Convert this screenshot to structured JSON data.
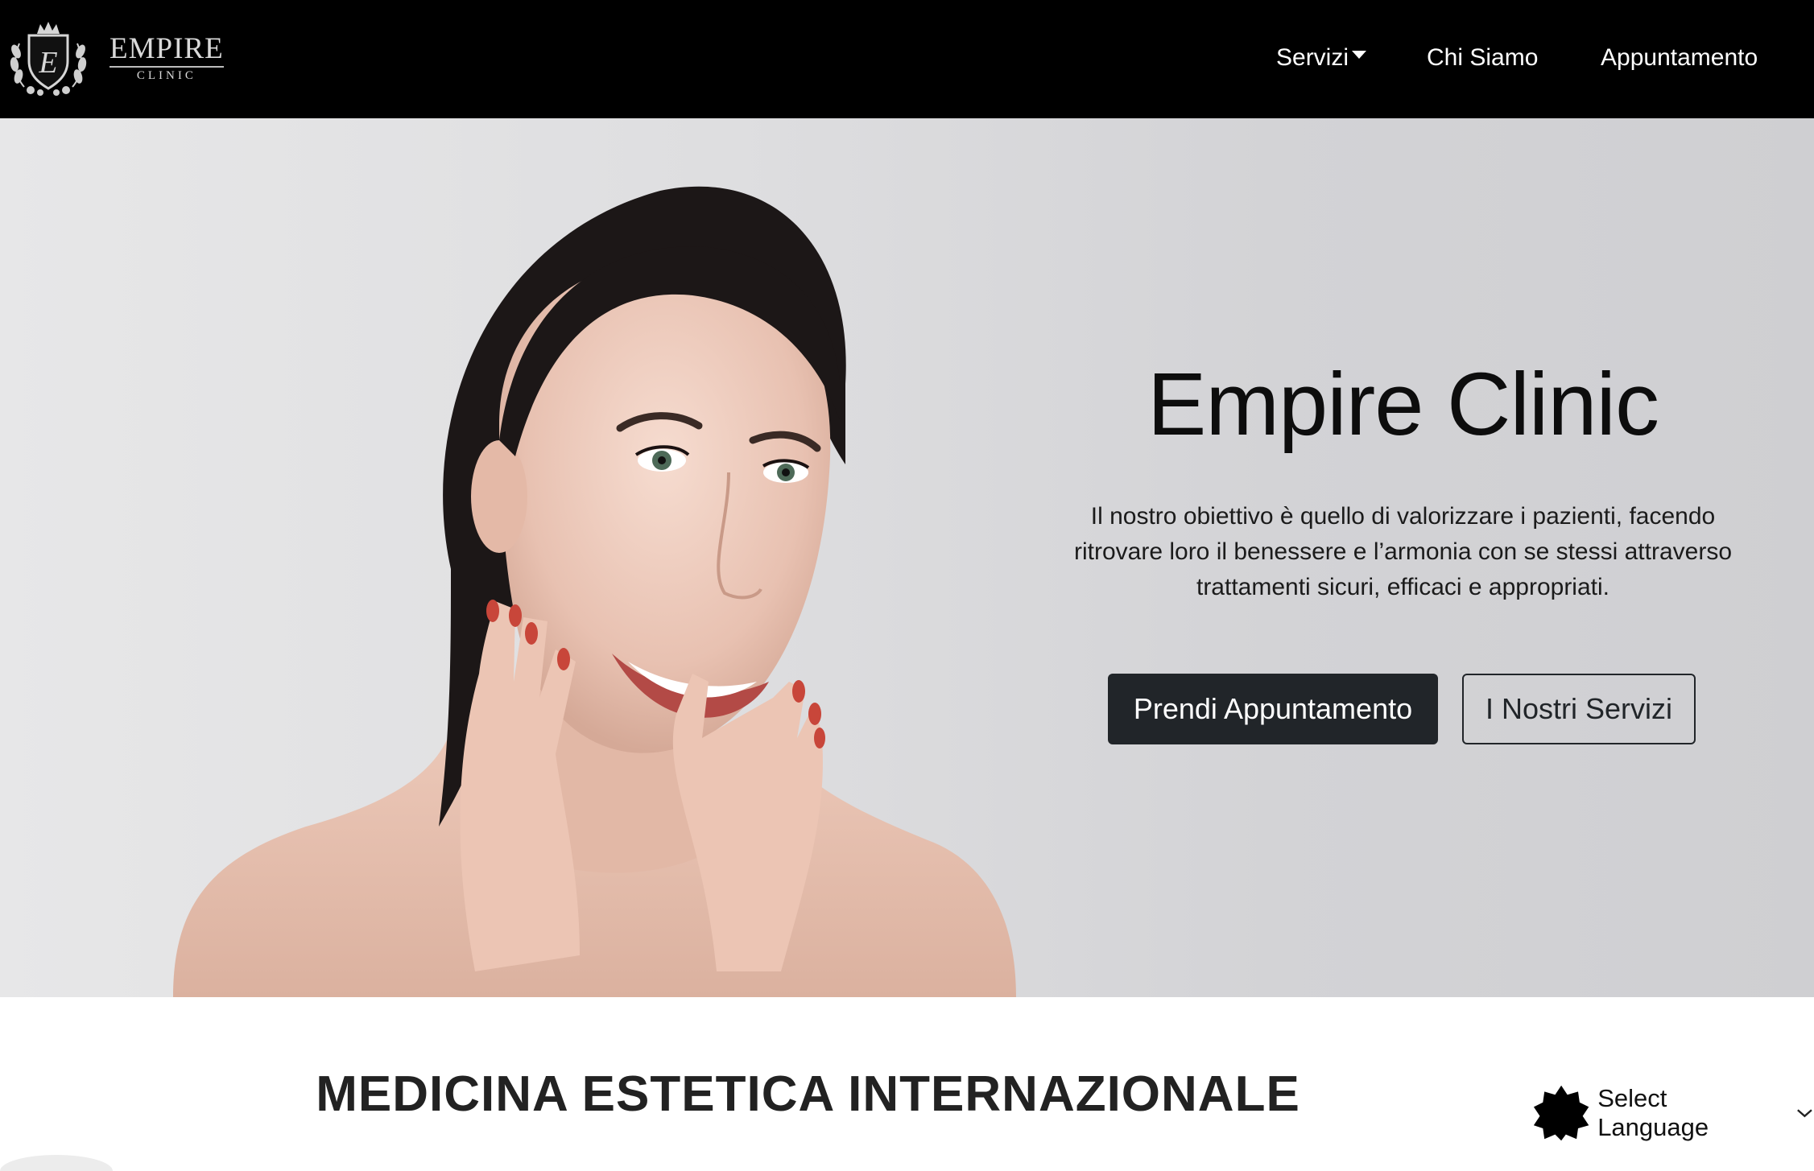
{
  "brand": {
    "name": "EMPIRE",
    "sub": "CLINIC",
    "monogram": "E",
    "crest_icon": "crest-logo-icon"
  },
  "nav": {
    "items": [
      {
        "label": "Servizi",
        "has_dropdown": true,
        "icon": "caret-down-icon"
      },
      {
        "label": "Chi Siamo"
      },
      {
        "label": "Appuntamento"
      }
    ]
  },
  "hero": {
    "title": "Empire Clinic",
    "text": "Il nostro obiettivo è quello di valorizzare i pazienti, facendo ritrovare loro il benessere e l’armonia con se stessi attraverso trattamenti sicuri, efficaci e appropriati.",
    "primary_button": "Prendi Appuntamento",
    "secondary_button": "I Nostri Servizi",
    "image": "woman-portrait-photo"
  },
  "section": {
    "title": "MEDICINA ESTETICA INTERNAZIONALE"
  },
  "language": {
    "label": "Select Language",
    "icon": "star-badge-icon",
    "chevron": "chevron-down-icon"
  },
  "colors": {
    "navbar_bg": "#000000",
    "button_dark": "#212529",
    "hero_bg": "#dcdcde",
    "nail_accent": "#c8463a"
  }
}
